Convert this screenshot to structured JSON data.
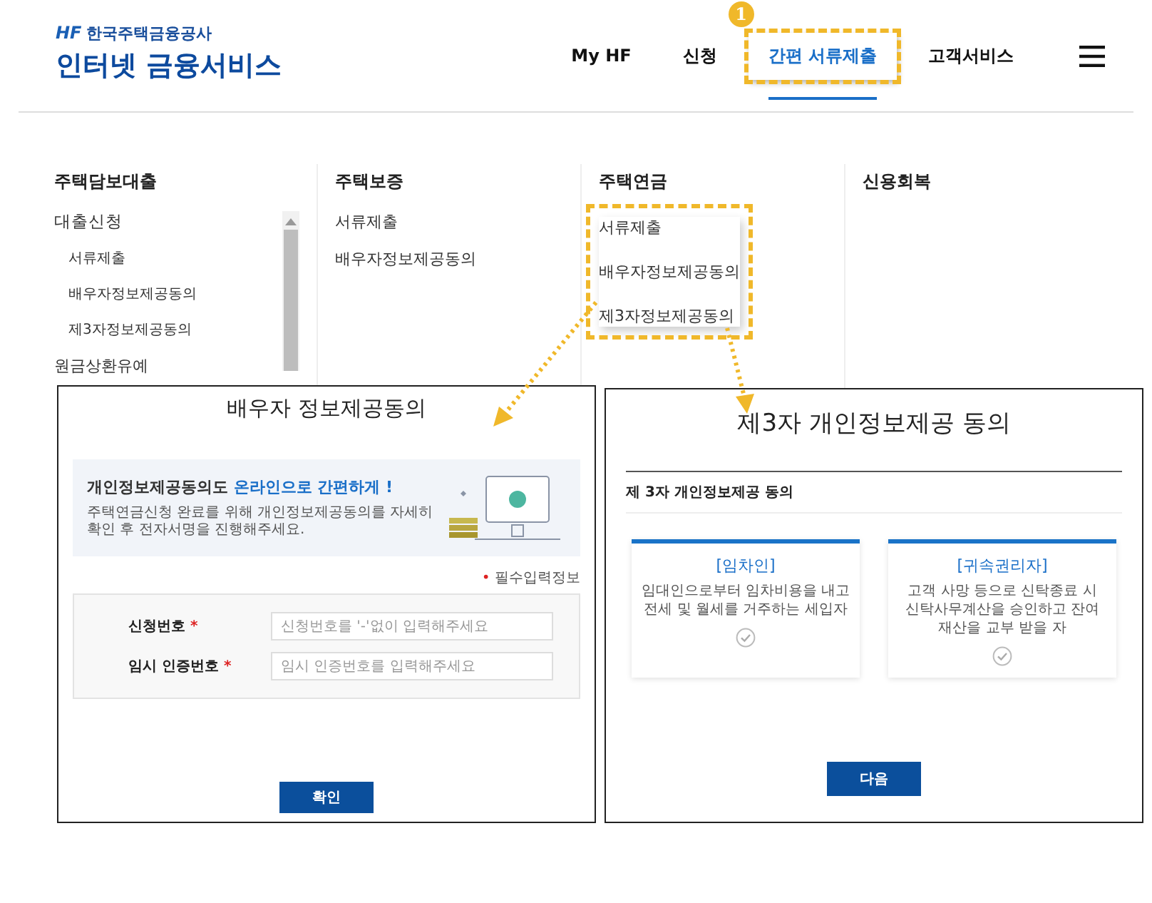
{
  "header": {
    "logo_mark": "HF",
    "org_name": "한국주택금융공사",
    "service_title": "인터넷 금융서비스"
  },
  "nav": [
    {
      "label": "My HF",
      "selected": false,
      "highlighted": false
    },
    {
      "label": "신청",
      "selected": false,
      "highlighted": false
    },
    {
      "label": "간편 서류제출",
      "selected": true,
      "highlighted": true
    },
    {
      "label": "고객서비스",
      "selected": false,
      "highlighted": false
    }
  ],
  "step_badge": "1",
  "menu_columns": [
    {
      "title": "주택담보대출",
      "highlighted": false,
      "scrollable": true,
      "items": [
        {
          "label": "대출신청",
          "children": [
            {
              "label": "서류제출"
            },
            {
              "label": "배우자정보제공동의"
            },
            {
              "label": "제3자정보제공동의"
            }
          ]
        },
        {
          "label": "원금상환유예"
        }
      ]
    },
    {
      "title": "주택보증",
      "highlighted": false,
      "scrollable": false,
      "items": [
        {
          "label": "서류제출"
        },
        {
          "label": "배우자정보제공동의"
        }
      ]
    },
    {
      "title": "주택연금",
      "highlighted": true,
      "scrollable": false,
      "items": [
        {
          "label": "서류제출"
        },
        {
          "label": "배우자정보제공동의"
        },
        {
          "label": "제3자정보제공동의"
        }
      ]
    },
    {
      "title": "신용회복",
      "highlighted": false,
      "scrollable": false
    }
  ],
  "spouse_panel": {
    "title": "배우자 정보제공동의",
    "heading": "개인정보제공동의도",
    "heading_emphasis": "온라인으로 간편하게 !",
    "description": "주택연금신청 완료를 위해 개인정보제공동의를 자세히 확인 후 전자서명을 진행해주세요.",
    "required_note": {
      "mark": "•",
      "text": "필수입력정보"
    },
    "fields": [
      {
        "label": "신청번호",
        "required_mark": "*",
        "placeholder": "신청번호를 '-'없이 입력해주세요"
      },
      {
        "label": "임시 인증번호",
        "required_mark": "*",
        "placeholder": "임시 인증번호를 입력해주세요"
      }
    ],
    "button": "확인"
  },
  "third_party_panel": {
    "title": "제3자 개인정보제공 동의",
    "section_title": "제 3자 개인정보제공 동의",
    "cards": [
      {
        "title": "[임차인]",
        "lines": [
          "임대인으로부터 임차비용을 내고",
          "전세 및 월세를 거주하는 세입자"
        ],
        "checked": false
      },
      {
        "title": "[귀속권리자]",
        "lines": [
          "고객 사망 등으로 신탁종료 시",
          "신탁사무계산을 승인하고 잔여",
          "재산을 교부 받을 자"
        ],
        "checked": false
      }
    ],
    "button": "다음"
  }
}
